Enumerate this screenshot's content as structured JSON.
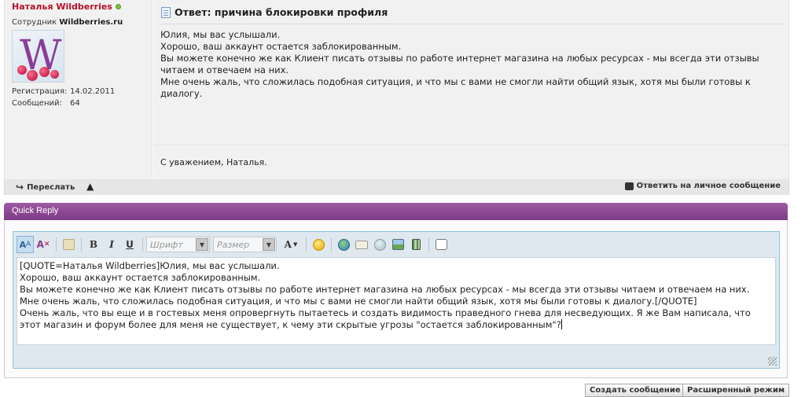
{
  "post": {
    "username": "Наталья Wildberries",
    "user_title_prefix": "Сотрудник",
    "user_title_site": "Wildberries.ru",
    "avatar_letter": "W",
    "stats": [
      {
        "label": "Регистрация:",
        "value": "14.02.2011"
      },
      {
        "label": "Сообщений:",
        "value": "64"
      }
    ],
    "title": "Ответ: причина блокировки профиля",
    "body_lines": [
      "Юлия, мы вас услышали.",
      "Хорошо, ваш аккаунт остается заблокированным.",
      "Вы можете конечно же как Клиент писать отзывы по работе интернет магазина на любых ресурсах - мы всегда эти отзывы читаем и отвечаем на них.",
      "Мне очень жаль, что сложилась подобная ситуация, и что мы с вами не смогли найти общий язык, хотя мы были готовы к диалогу."
    ],
    "signature": "С уважением, Наталья.",
    "forward_label": "Переслать",
    "warn_glyph": "▲",
    "pm_label": "Ответить на личное сообщение"
  },
  "quick_reply": {
    "header": "Quick Reply",
    "toolbar": {
      "bold": "B",
      "italic": "I",
      "underline": "U",
      "font_placeholder": "Шрифт",
      "size_placeholder": "Размер",
      "color_glyph": "A",
      "dropdown_glyph": "▼"
    },
    "text_lines": [
      "[QUOTE=Наталья Wildberries]Юлия, мы вас услышали.",
      "Хорошо, ваш аккаунт остается заблокированным.",
      "Вы можете конечно же как Клиент писать отзывы по работе интернет магазина на любых ресурсах - мы всегда эти отзывы читаем и отвечаем на них.",
      "Мне очень жаль, что сложилась подобная ситуация, и что мы с вами не смогли найти общий язык, хотя мы были готовы к диалогу.[/QUOTE]",
      "Очень жаль, что вы еще и в гостевых меня опровергнуть пытаетесь и создать видимость праведного гнева для несведующих. Я же Вам написала, что этот магазин и форум более для меня не существует, к чему эти скрытые угрозы \"остается заблокированным\"?"
    ],
    "submit_label": "Создать сообщение",
    "advanced_label": "Расширенный режим"
  },
  "colors": {
    "username": "#b5122e",
    "online": "#7bc142",
    "qr_header": "#8a4a92",
    "editor_border": "#8ec2df"
  }
}
